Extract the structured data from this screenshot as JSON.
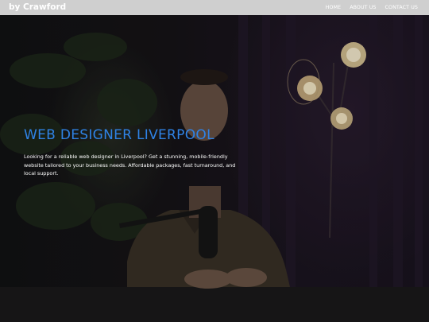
{
  "header": {
    "brand": "by Crawford",
    "nav": [
      {
        "label": "HOME"
      },
      {
        "label": "ABOUT US"
      },
      {
        "label": "CONTACT US"
      }
    ]
  },
  "hero": {
    "title": "WEB DESIGNER LIVERPOOL",
    "description": "Looking for a reliable web designer in Liverpool? Get a stunning, mobile-friendly website tailored to your business needs. Affordable packages, fast turnaround, and local support.",
    "title_color": "#2f83e6"
  }
}
